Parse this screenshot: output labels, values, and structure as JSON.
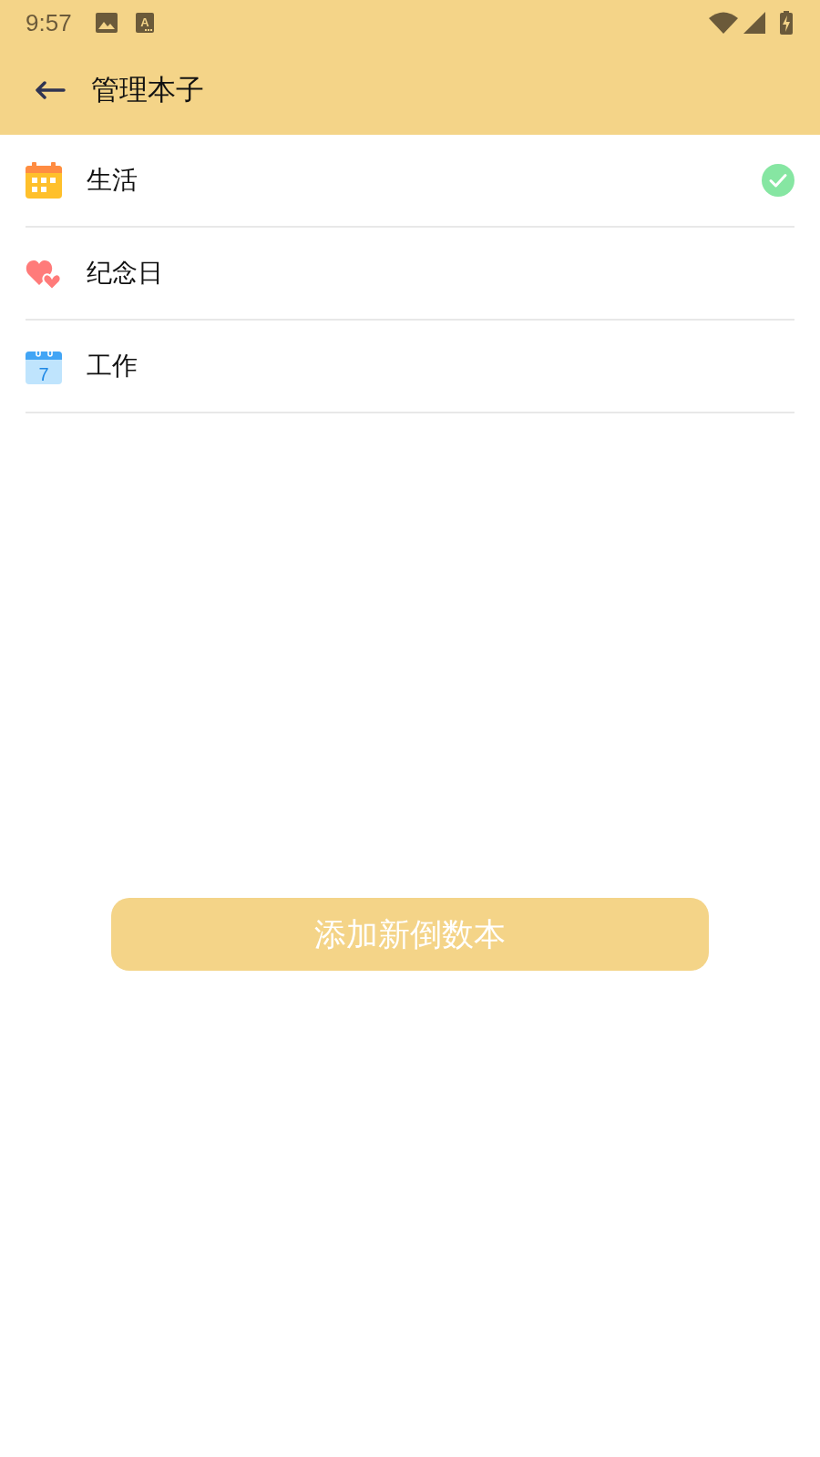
{
  "status_bar": {
    "time": "9:57",
    "notifications": [
      {
        "kind": "image"
      },
      {
        "kind": "font",
        "text": "A"
      }
    ]
  },
  "app_bar": {
    "title": "管理本子"
  },
  "notebooks": [
    {
      "name": "生活",
      "kind": "planner",
      "selected": true
    },
    {
      "name": "纪念日",
      "kind": "hearts",
      "selected": false
    },
    {
      "name": "工作",
      "kind": "calendar",
      "icon_text": "7",
      "selected": false
    }
  ],
  "add_button": {
    "label": "添加新倒数本"
  }
}
